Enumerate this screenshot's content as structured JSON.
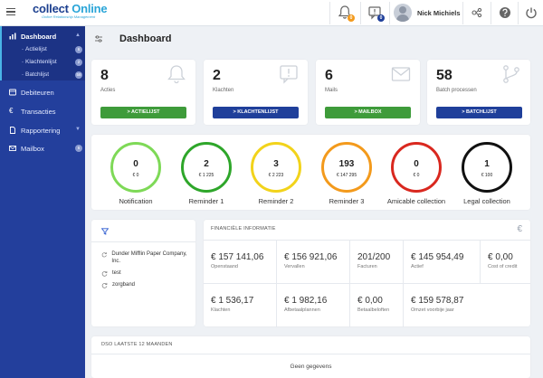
{
  "app": {
    "logo_prefix": "collect ",
    "logo_accent": "Online",
    "logo_tagline": "Online Relationship Management"
  },
  "topbar": {
    "notifications_count": "0",
    "messages_count": "0",
    "user_name": "Nick Michiels"
  },
  "sidebar": {
    "dashboard": "Dashboard",
    "sub_items": [
      {
        "label": "Actielijst",
        "count": "6"
      },
      {
        "label": "Klachtenlijst",
        "count": "2"
      },
      {
        "label": "Batchlijst",
        "count": "58"
      }
    ],
    "debiteuren": "Debiteuren",
    "transacties": "Transacties",
    "rapportering": "Rapportering",
    "mailbox": "Mailbox",
    "mailbox_count": "6"
  },
  "page": {
    "title": "Dashboard"
  },
  "stats": [
    {
      "value": "8",
      "label": "Acties",
      "button": "> ACTIELIJST",
      "icon": "bell-icon"
    },
    {
      "value": "2",
      "label": "Klachten",
      "button": "> KLACHTENLIJST",
      "icon": "complaint-icon"
    },
    {
      "value": "6",
      "label": "Mails",
      "button": "> MAILBOX",
      "icon": "envelope-icon"
    },
    {
      "value": "58",
      "label": "Batch processen",
      "button": "> BATCHLIJST",
      "icon": "branch-icon"
    }
  ],
  "rings": [
    {
      "count": "0",
      "amount": "€ 0",
      "label": "Notification",
      "color": "#7ed957"
    },
    {
      "count": "2",
      "amount": "€ 1 225",
      "label": "Reminder 1",
      "color": "#2ea62a"
    },
    {
      "count": "3",
      "amount": "€ 2 223",
      "label": "Reminder 2",
      "color": "#f2d31b"
    },
    {
      "count": "193",
      "amount": "€ 147 295",
      "label": "Reminder 3",
      "color": "#f39a1c"
    },
    {
      "count": "0",
      "amount": "€ 0",
      "label": "Amicable collection",
      "color": "#d9281f"
    },
    {
      "count": "1",
      "amount": "€ 100",
      "label": "Legal collection",
      "color": "#111111"
    }
  ],
  "list": {
    "items": [
      "Dunder Mifflin Paper Company, Inc.",
      "test",
      "zorgband"
    ]
  },
  "financial": {
    "title": "FINANCIËLE INFORMATIE",
    "row1": [
      {
        "value": "€ 157 141,06",
        "label": "Openstaand"
      },
      {
        "value": "€ 156 921,06",
        "label": "Vervallen"
      },
      {
        "value": "201/200",
        "label": "Facturen"
      },
      {
        "value": "€ 145 954,49",
        "label": "Actief"
      },
      {
        "value": "€ 0,00",
        "label": "Cost of credit"
      }
    ],
    "row2": [
      {
        "value": "€ 1 536,17",
        "label": "Klachten"
      },
      {
        "value": "€ 1 982,16",
        "label": "Afbetaalplannen"
      },
      {
        "value": "€ 0,00",
        "label": "Betaalbeloften"
      },
      {
        "value": "€ 159 578,87",
        "label": "Omzet voorbije jaar"
      }
    ]
  },
  "dso": {
    "title": "DSO LAATSTE 12 MAANDEN",
    "empty": "Geen gegevens"
  },
  "colors": {
    "sidebar": "#233f9c",
    "green_button": "#3e9b3a",
    "blue_button": "#1f3f9a",
    "badge_orange": "#f39a1c",
    "badge_green": "#3e9b3a"
  }
}
